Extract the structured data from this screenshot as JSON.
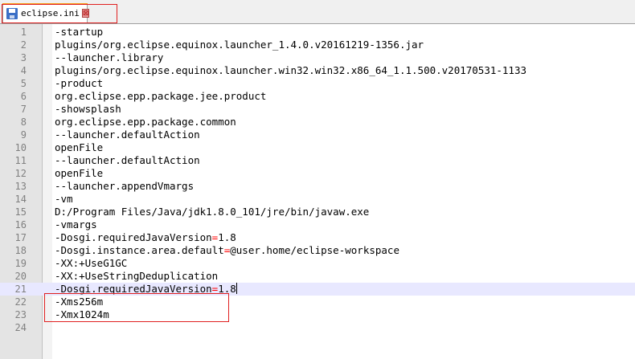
{
  "tab": {
    "title": "eclipse.ini",
    "close": "⊠"
  },
  "lines": [
    {
      "num": "1",
      "text": "-startup"
    },
    {
      "num": "2",
      "text": "plugins/org.eclipse.equinox.launcher_1.4.0.v20161219-1356.jar"
    },
    {
      "num": "3",
      "text": "--launcher.library"
    },
    {
      "num": "4",
      "text": "plugins/org.eclipse.equinox.launcher.win32.win32.x86_64_1.1.500.v20170531-1133"
    },
    {
      "num": "5",
      "text": "-product"
    },
    {
      "num": "6",
      "text": "org.eclipse.epp.package.jee.product"
    },
    {
      "num": "7",
      "text": "-showsplash"
    },
    {
      "num": "8",
      "text": "org.eclipse.epp.package.common"
    },
    {
      "num": "9",
      "text": "--launcher.defaultAction"
    },
    {
      "num": "10",
      "text": "openFile"
    },
    {
      "num": "11",
      "text": "--launcher.defaultAction"
    },
    {
      "num": "12",
      "text": "openFile"
    },
    {
      "num": "13",
      "text": "--launcher.appendVmargs"
    },
    {
      "num": "14",
      "text": "-vm"
    },
    {
      "num": "15",
      "text": "D:/Program Files/Java/jdk1.8.0_101/jre/bin/javaw.exe"
    },
    {
      "num": "16",
      "text": "-vmargs"
    },
    {
      "num": "17",
      "text": "-Dosgi.requiredJavaVersion=1.8"
    },
    {
      "num": "18",
      "text": "-Dosgi.instance.area.default=@user.home/eclipse-workspace"
    },
    {
      "num": "19",
      "text": "-XX:+UseG1GC"
    },
    {
      "num": "20",
      "text": "-XX:+UseStringDeduplication"
    },
    {
      "num": "21",
      "text": "-Dosgi.requiredJavaVersion=1.8"
    },
    {
      "num": "22",
      "text": "-Xms256m"
    },
    {
      "num": "23",
      "text": "-Xmx1024m"
    },
    {
      "num": "24",
      "text": ""
    }
  ],
  "current_line": 21,
  "colors": {
    "current_line_bg": "#e8e8ff",
    "highlight_box": "#e02020",
    "operator": "#ff0000"
  }
}
